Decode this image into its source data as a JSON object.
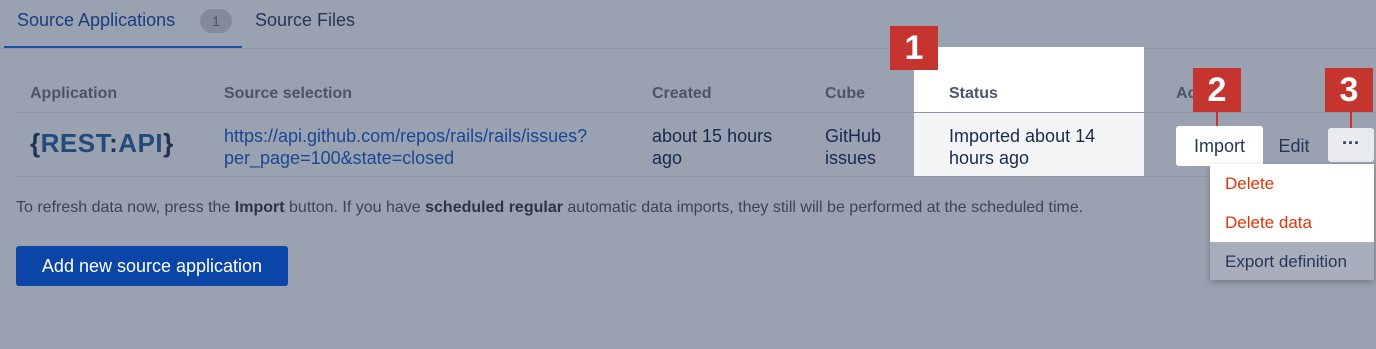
{
  "tabs": {
    "source_applications": "Source Applications",
    "source_applications_count": "1",
    "source_files": "Source Files"
  },
  "table": {
    "headers": {
      "application": "Application",
      "source_selection": "Source selection",
      "created": "Created",
      "cube": "Cube",
      "status": "Status",
      "actions": "Ac"
    },
    "row": {
      "logo_brace_open": "{",
      "logo_rest": "REST",
      "logo_colon": ":",
      "logo_api": "API",
      "logo_brace_close": "}",
      "source_line1": "https://api.github.com/repos/rails/rails/issues?",
      "source_line2": "per_page=100&state=closed",
      "created_line1": "about 15 hours",
      "created_line2": "ago",
      "cube_line1": "GitHub",
      "cube_line2": "issues",
      "status_line1": "Imported about 14",
      "status_line2": "hours ago"
    }
  },
  "actions": {
    "import": "Import",
    "edit": "Edit",
    "more": "···"
  },
  "menu": {
    "delete": "Delete",
    "delete_data": "Delete data",
    "export_definition": "Export definition"
  },
  "badges": [
    "1",
    "2",
    "3"
  ],
  "help": {
    "part1": "To refresh data now, press the ",
    "bold1": "Import",
    "part2": " button. If you have ",
    "bold2": "scheduled regular",
    "part3": " automatic data imports, they still will be performed at the scheduled time."
  },
  "add_button": "Add new source application",
  "colors": {
    "overlay_background": "#9aa1b0",
    "primary_button": "#0b45a8",
    "badge": "#c6342f",
    "danger_text": "#de350b",
    "link": "#1a4793"
  }
}
